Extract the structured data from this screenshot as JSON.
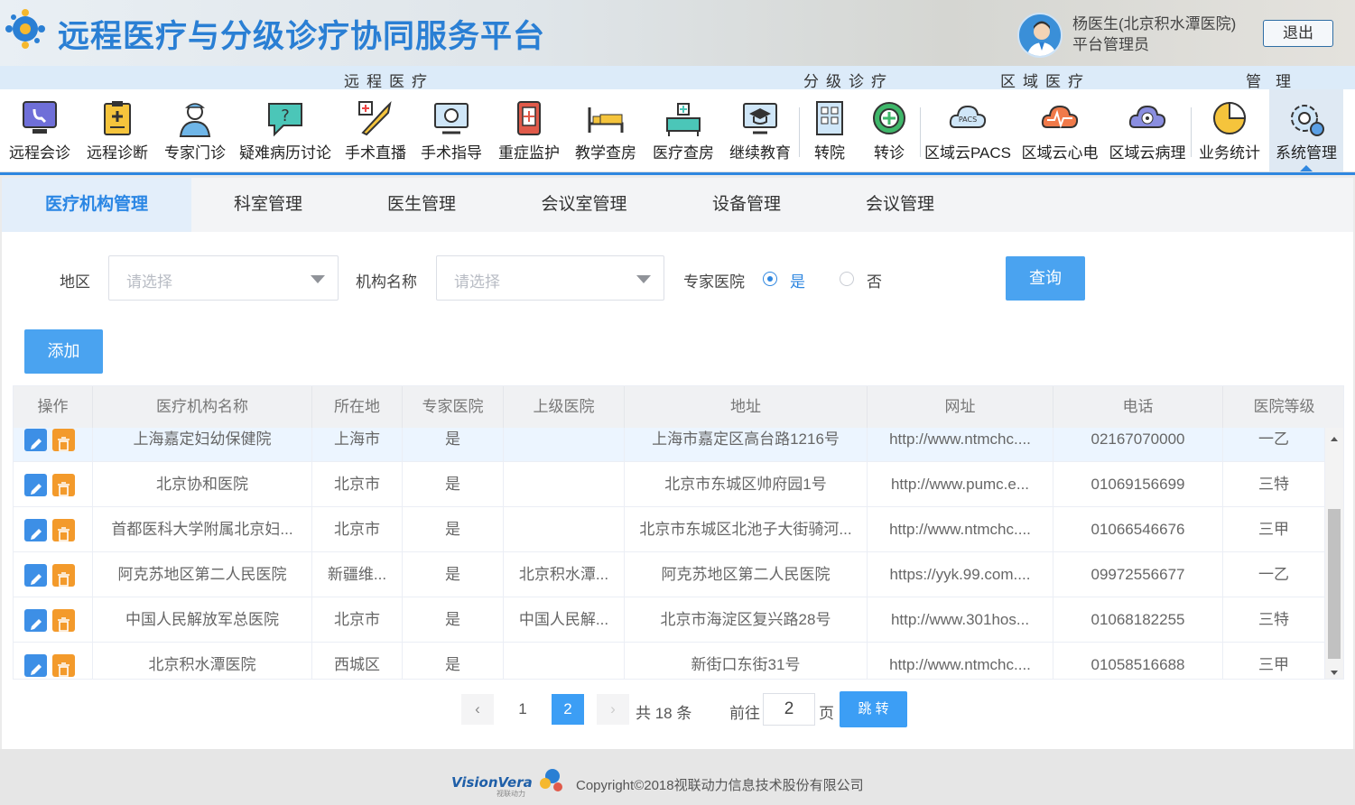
{
  "header": {
    "app_title": "远程医疗与分级诊疗协同服务平台",
    "user_name": "杨医生(北京积水潭医院)",
    "user_role": "平台管理员",
    "logout_label": "退出"
  },
  "groups": [
    "远程医疗",
    "分级诊疗",
    "区域医疗",
    "管理"
  ],
  "modules": [
    {
      "label": "远程会诊",
      "icon": "remote-consult-icon"
    },
    {
      "label": "远程诊断",
      "icon": "clipboard-medical-icon"
    },
    {
      "label": "专家门诊",
      "icon": "nurse-icon"
    },
    {
      "label": "疑难病历讨论",
      "icon": "question-bubble-icon"
    },
    {
      "label": "手术直播",
      "icon": "scalpel-icon"
    },
    {
      "label": "手术指导",
      "icon": "surgery-monitor-icon"
    },
    {
      "label": "重症监护",
      "icon": "icu-icon"
    },
    {
      "label": "教学查房",
      "icon": "bed-icon"
    },
    {
      "label": "医疗查房",
      "icon": "ward-round-icon"
    },
    {
      "label": "继续教育",
      "icon": "graduation-cap-icon"
    },
    {
      "label": "转院",
      "icon": "hospital-transfer-icon"
    },
    {
      "label": "转诊",
      "icon": "referral-icon"
    },
    {
      "label": "区域云PACS",
      "icon": "cloud-pacs-icon"
    },
    {
      "label": "区域云心电",
      "icon": "cloud-ecg-icon"
    },
    {
      "label": "区域云病理",
      "icon": "cloud-pathology-icon"
    },
    {
      "label": "业务统计",
      "icon": "pie-chart-icon"
    },
    {
      "label": "系统管理",
      "icon": "gear-icon"
    }
  ],
  "active_module": "系统管理",
  "subtabs": [
    "医疗机构管理",
    "科室管理",
    "医生管理",
    "会议室管理",
    "设备管理",
    "会议管理"
  ],
  "active_subtab": "医疗机构管理",
  "filters": {
    "region_label": "地区",
    "region_placeholder": "请选择",
    "org_name_label": "机构名称",
    "org_name_placeholder": "请选择",
    "expert_label": "专家医院",
    "yes_label": "是",
    "no_label": "否",
    "expert_selected": "是",
    "query_label": "查询"
  },
  "add_label": "添加",
  "table": {
    "columns": [
      "操作",
      "医疗机构名称",
      "所在地",
      "专家医院",
      "上级医院",
      "地址",
      "网址",
      "电话",
      "医院等级"
    ],
    "rows": [
      {
        "name": "上海嘉定妇幼保健院",
        "location": "上海市",
        "expert": "是",
        "parent": "",
        "address": "上海市嘉定区高台路1216号",
        "website": "http://www.ntmchc....",
        "phone": "02167070000",
        "level": "一乙"
      },
      {
        "name": "北京协和医院",
        "location": "北京市",
        "expert": "是",
        "parent": "",
        "address": "北京市东城区帅府园1号",
        "website": "http://www.pumc.e...",
        "phone": "01069156699",
        "level": "三特"
      },
      {
        "name": "首都医科大学附属北京妇...",
        "location": "北京市",
        "expert": "是",
        "parent": "",
        "address": "北京市东城区北池子大街骑河...",
        "website": "http://www.ntmchc....",
        "phone": "01066546676",
        "level": "三甲"
      },
      {
        "name": "阿克苏地区第二人民医院",
        "location": "新疆维...",
        "expert": "是",
        "parent": "北京积水潭...",
        "address": "阿克苏地区第二人民医院",
        "website": "https://yyk.99.com....",
        "phone": "09972556677",
        "level": "一乙"
      },
      {
        "name": "中国人民解放军总医院",
        "location": "北京市",
        "expert": "是",
        "parent": "中国人民解...",
        "address": "北京市海淀区复兴路28号",
        "website": "http://www.301hos...",
        "phone": "01068182255",
        "level": "三特"
      },
      {
        "name": "北京积水潭医院",
        "location": "西城区",
        "expert": "是",
        "parent": "",
        "address": "新街口东街31号",
        "website": "http://www.ntmchc....",
        "phone": "01058516688",
        "level": "三甲"
      }
    ]
  },
  "pagination": {
    "pages": [
      "1",
      "2"
    ],
    "current": "2",
    "total_text": "共 18 条",
    "goto_label": "前往",
    "page_value": "2",
    "page_unit": "页",
    "jump_label": "跳 转"
  },
  "footer": {
    "brand": "VisionVera",
    "brand_sub": "视联动力",
    "copyright": "Copyright©2018视联动力信息技术股份有限公司"
  },
  "colors": {
    "brand_blue": "#2a7fd4",
    "primary_button": "#4aa3f0",
    "edit_icon": "#3d8fe6",
    "delete_icon": "#f39a2b"
  }
}
